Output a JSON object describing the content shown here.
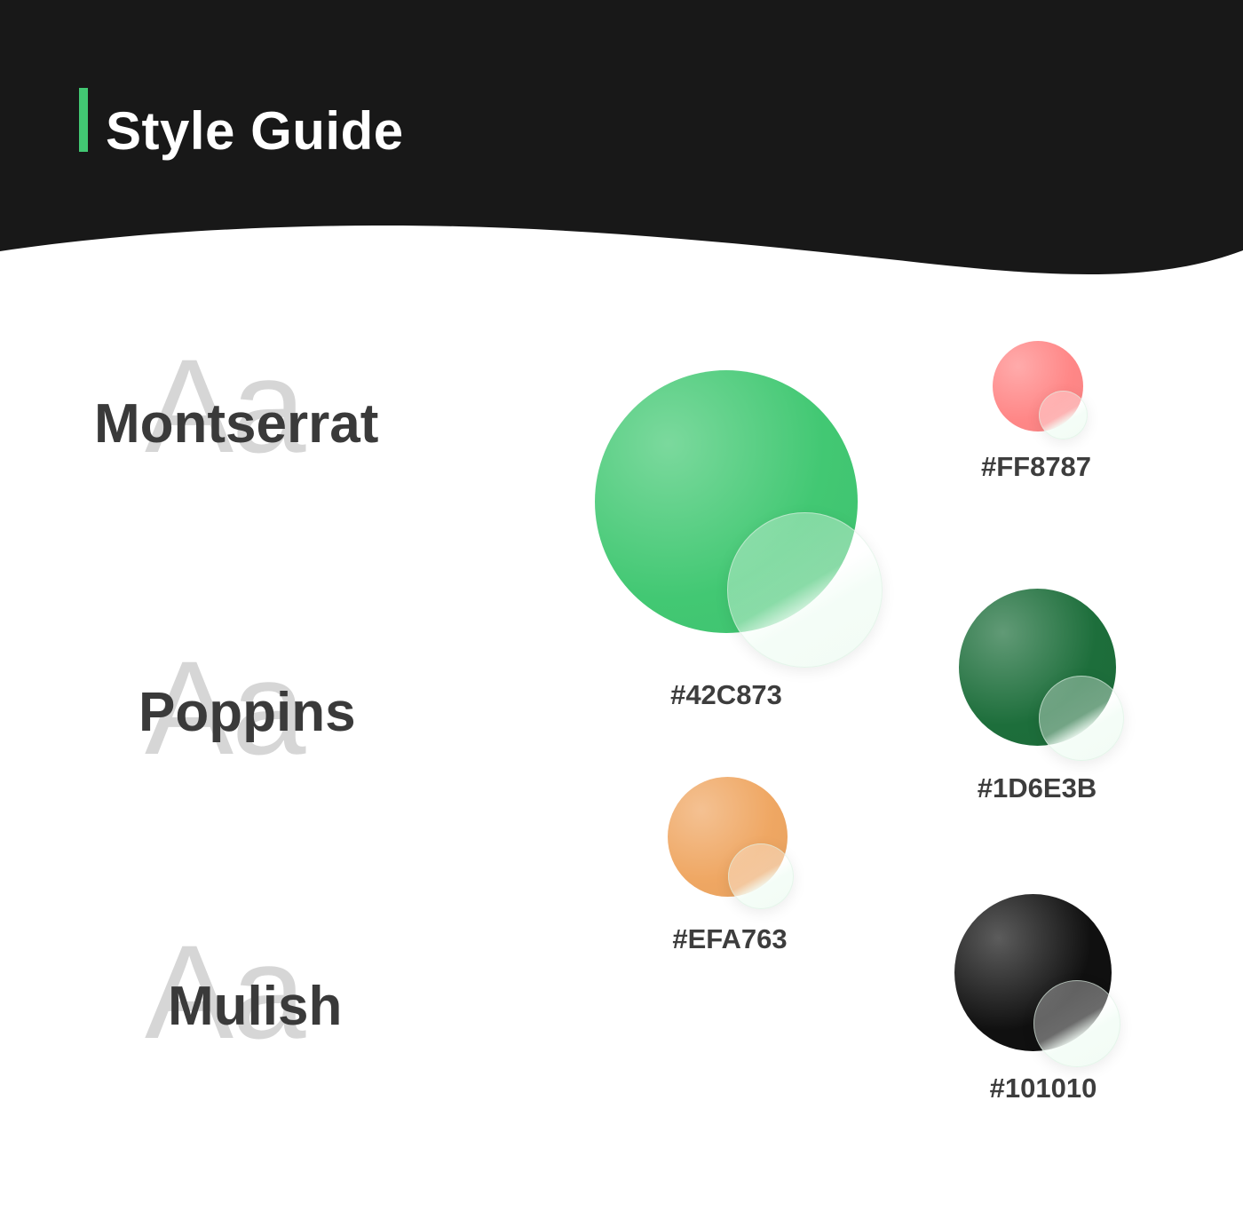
{
  "header": {
    "title": "Style Guide",
    "background_color": "#181818",
    "accent_color": "#42C873"
  },
  "fonts": [
    {
      "ghost": "Aa",
      "name": "Montserrat"
    },
    {
      "ghost": "Aa",
      "name": "Poppins"
    },
    {
      "ghost": "Aa",
      "name": "Mulish"
    }
  ],
  "colors": [
    {
      "hex": "#42C873",
      "label": "#42C873"
    },
    {
      "hex": "#FF8787",
      "label": "#FF8787"
    },
    {
      "hex": "#1D6E3B",
      "label": "#1D6E3B"
    },
    {
      "hex": "#EFA763",
      "label": "#EFA763"
    },
    {
      "hex": "#101010",
      "label": "#101010"
    }
  ]
}
